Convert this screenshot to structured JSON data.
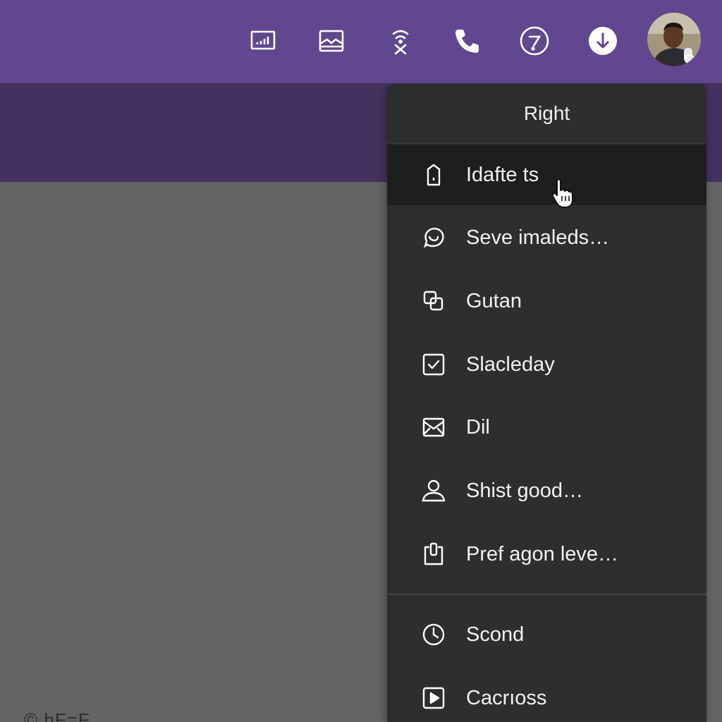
{
  "toolbar": {
    "icons": [
      {
        "name": "stats-icon"
      },
      {
        "name": "tray-icon"
      },
      {
        "name": "signal-off-icon"
      },
      {
        "name": "phone-icon"
      },
      {
        "name": "help-circle-icon"
      },
      {
        "name": "download-icon"
      }
    ]
  },
  "menu": {
    "header": "Right",
    "items": [
      {
        "label": "Idafte ts",
        "icon": "door-icon",
        "active": true
      },
      {
        "label": "Seve imaleds…",
        "icon": "chat-bubble-icon"
      },
      {
        "label": "Gutan",
        "icon": "copy-icon"
      },
      {
        "label": "Slacleday",
        "icon": "checkbox-icon"
      },
      {
        "label": "Dil",
        "icon": "mail-icon"
      },
      {
        "label": "Shist good…",
        "icon": "person-icon"
      },
      {
        "label": "Pref agon leve…",
        "icon": "clipboard-icon"
      },
      {
        "label": "Scond",
        "icon": "clock-icon"
      },
      {
        "label": "Cacrıoss",
        "icon": "play-icon"
      }
    ]
  },
  "footer": {
    "text": "© hF=F"
  },
  "colors": {
    "topbar": "#62478f",
    "subbar": "#45315f",
    "content": "#646464",
    "menu": "#2e2e2e",
    "menu_active": "#1e1e1e"
  }
}
